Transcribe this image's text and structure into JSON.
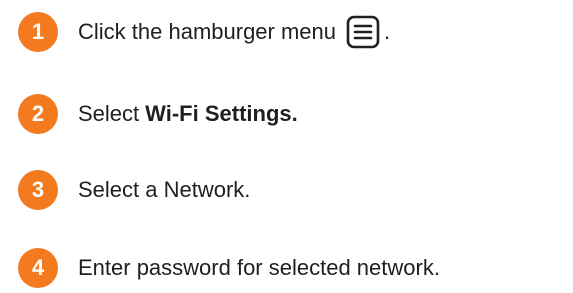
{
  "steps": [
    {
      "number": "1",
      "text_before": "Click the hamburger menu",
      "icon": "hamburger-menu-icon",
      "text_after": "."
    },
    {
      "number": "2",
      "text": "Select",
      "bold_text": "Wi-Fi Settings."
    },
    {
      "number": "3",
      "text": "Select a Network."
    },
    {
      "number": "4",
      "text": "Enter password for selected network."
    }
  ],
  "colors": {
    "badge": "#f47a20",
    "text": "#1f1f1f"
  }
}
